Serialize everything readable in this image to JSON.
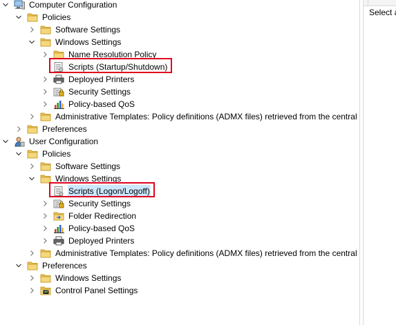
{
  "tree": [
    {
      "depth": 0,
      "state": "open",
      "icon": "computer-icon",
      "label": "Computer Configuration"
    },
    {
      "depth": 1,
      "state": "open",
      "icon": "folder-icon",
      "label": "Policies"
    },
    {
      "depth": 2,
      "state": "closed",
      "icon": "folder-icon",
      "label": "Software Settings"
    },
    {
      "depth": 2,
      "state": "open",
      "icon": "folder-icon",
      "label": "Windows Settings"
    },
    {
      "depth": 3,
      "state": "closed",
      "icon": "folder-icon",
      "label": "Name Resolution Policy"
    },
    {
      "depth": 3,
      "state": "none",
      "icon": "script-icon",
      "label": "Scripts (Startup/Shutdown)"
    },
    {
      "depth": 3,
      "state": "closed",
      "icon": "printer-icon",
      "label": "Deployed Printers"
    },
    {
      "depth": 3,
      "state": "closed",
      "icon": "security-icon",
      "label": "Security Settings"
    },
    {
      "depth": 3,
      "state": "closed",
      "icon": "qos-chart-icon",
      "label": "Policy-based QoS"
    },
    {
      "depth": 2,
      "state": "closed",
      "icon": "folder-icon",
      "label": "Administrative Templates: Policy definitions (ADMX files) retrieved from the central s"
    },
    {
      "depth": 1,
      "state": "closed",
      "icon": "folder-icon",
      "label": "Preferences"
    },
    {
      "depth": 0,
      "state": "open",
      "icon": "user-icon",
      "label": "User Configuration"
    },
    {
      "depth": 1,
      "state": "open",
      "icon": "folder-icon",
      "label": "Policies"
    },
    {
      "depth": 2,
      "state": "closed",
      "icon": "folder-icon",
      "label": "Software Settings"
    },
    {
      "depth": 2,
      "state": "open",
      "icon": "folder-icon",
      "label": "Windows Settings"
    },
    {
      "depth": 3,
      "state": "none",
      "icon": "script-icon",
      "label": "Scripts (Logon/Logoff)",
      "selected": true
    },
    {
      "depth": 3,
      "state": "closed",
      "icon": "security-icon",
      "label": "Security Settings"
    },
    {
      "depth": 3,
      "state": "closed",
      "icon": "folder-redirect-icon",
      "label": "Folder Redirection"
    },
    {
      "depth": 3,
      "state": "closed",
      "icon": "qos-chart-icon",
      "label": "Policy-based QoS"
    },
    {
      "depth": 3,
      "state": "closed",
      "icon": "printer-icon",
      "label": "Deployed Printers"
    },
    {
      "depth": 2,
      "state": "closed",
      "icon": "folder-icon",
      "label": "Administrative Templates: Policy definitions (ADMX files) retrieved from the central s"
    },
    {
      "depth": 1,
      "state": "open",
      "icon": "folder-icon",
      "label": "Preferences"
    },
    {
      "depth": 2,
      "state": "closed",
      "icon": "folder-icon",
      "label": "Windows Settings"
    },
    {
      "depth": 2,
      "state": "closed",
      "icon": "control-panel-icon",
      "label": "Control Panel Settings"
    }
  ],
  "right_pane": {
    "text": "Select a"
  },
  "highlights": [
    "Scripts (Startup/Shutdown)",
    "Scripts (Logon/Logoff)"
  ],
  "colors": {
    "highlight_box": "#e0001b",
    "selection": "#cce8ff"
  }
}
